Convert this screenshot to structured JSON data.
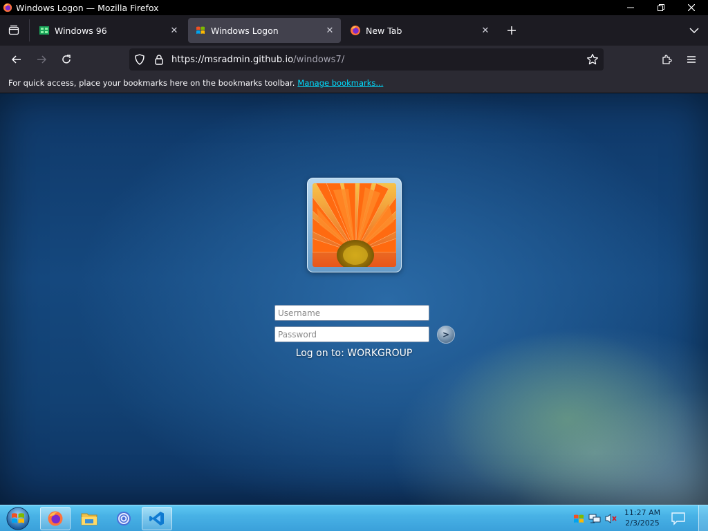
{
  "window": {
    "title": "Windows Logon — Mozilla Firefox"
  },
  "tabs": [
    {
      "label": "Windows 96",
      "active": false
    },
    {
      "label": "Windows Logon",
      "active": true
    },
    {
      "label": "New Tab",
      "active": false
    }
  ],
  "navbar": {
    "url_host": "https://msradmin.github.io",
    "url_path": "/windows7/"
  },
  "bookmarks_bar": {
    "message": "For quick access, place your bookmarks here on the bookmarks toolbar.",
    "link": "Manage bookmarks..."
  },
  "logon": {
    "username_placeholder": "Username",
    "password_placeholder": "Password",
    "go_label": ">",
    "logon_to": "Log on to: WORKGROUP"
  },
  "taskbar": {
    "time": "11:27 AM",
    "date": "2/3/2025"
  },
  "colors": {
    "accent_link": "#00ddff",
    "taskbar": "#48b2e6",
    "desktop_blue": "#15487e"
  },
  "icons": [
    "firefox-icon",
    "windows96-icon",
    "windows-logon-favicon",
    "tab-overview-icon",
    "back-icon",
    "forward-icon",
    "reload-icon",
    "shield-icon",
    "lock-icon",
    "star-icon",
    "extensions-icon",
    "menu-icon",
    "start-orb-icon",
    "file-explorer-icon",
    "app-icon",
    "vscode-icon",
    "flag-icon",
    "network-icon",
    "volume-muted-icon",
    "action-center-icon"
  ]
}
